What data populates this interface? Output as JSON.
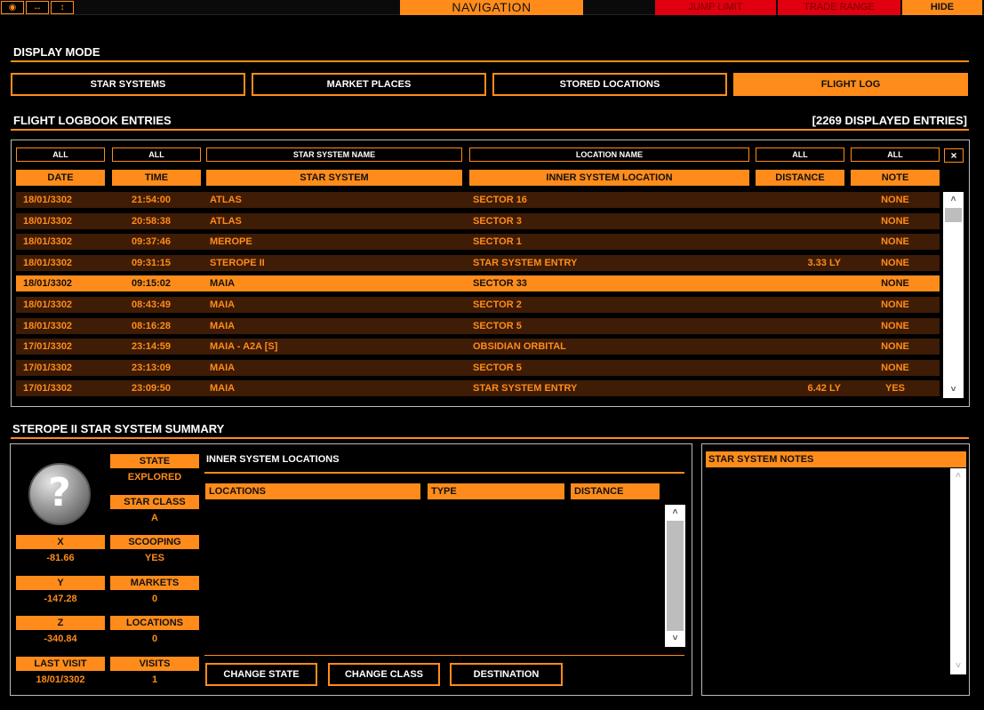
{
  "topbar": {
    "icons": [
      "eye-icon",
      "horizontal-arrows-icon",
      "vertical-arrows-icon"
    ],
    "icon_glyphs": [
      "◉",
      "↔",
      "↕"
    ],
    "title": "NAVIGATION",
    "jump_limit": "JUMP LIMIT",
    "trade_range": "TRADE RANGE",
    "hide": "HIDE"
  },
  "display_mode": {
    "title": "DISPLAY MODE",
    "buttons": [
      "STAR SYSTEMS",
      "MARKET PLACES",
      "STORED LOCATIONS",
      "FLIGHT LOG"
    ],
    "active": "FLIGHT LOG"
  },
  "logbook": {
    "title": "FLIGHT LOGBOOK ENTRIES",
    "count": "[2269 DISPLAYED ENTRIES]",
    "filters": [
      "ALL",
      "ALL",
      "STAR SYSTEM NAME",
      "LOCATION NAME",
      "ALL",
      "ALL"
    ],
    "clear": "×",
    "columns": [
      "DATE",
      "TIME",
      "STAR SYSTEM",
      "INNER SYSTEM LOCATION",
      "DISTANCE",
      "NOTE"
    ],
    "rows": [
      {
        "date": "18/01/3302",
        "time": "21:54:00",
        "system": "ATLAS",
        "location": "SECTOR 16",
        "distance": "",
        "note": "NONE"
      },
      {
        "date": "18/01/3302",
        "time": "20:58:38",
        "system": "ATLAS",
        "location": "SECTOR 3",
        "distance": "",
        "note": "NONE"
      },
      {
        "date": "18/01/3302",
        "time": "09:37:46",
        "system": "MEROPE",
        "location": "SECTOR 1",
        "distance": "",
        "note": "NONE"
      },
      {
        "date": "18/01/3302",
        "time": "09:31:15",
        "system": "STEROPE II",
        "location": "STAR SYSTEM ENTRY",
        "distance": "3.33 LY",
        "note": "NONE"
      },
      {
        "date": "18/01/3302",
        "time": "09:15:02",
        "system": "MAIA",
        "location": "SECTOR 33",
        "distance": "",
        "note": "NONE"
      },
      {
        "date": "18/01/3302",
        "time": "08:43:49",
        "system": "MAIA",
        "location": "SECTOR 2",
        "distance": "",
        "note": "NONE"
      },
      {
        "date": "18/01/3302",
        "time": "08:16:28",
        "system": "MAIA",
        "location": "SECTOR 5",
        "distance": "",
        "note": "NONE"
      },
      {
        "date": "17/01/3302",
        "time": "23:14:59",
        "system": "MAIA - A2A [S]",
        "location": "OBSIDIAN ORBITAL",
        "distance": "",
        "note": "NONE"
      },
      {
        "date": "17/01/3302",
        "time": "23:13:09",
        "system": "MAIA",
        "location": "SECTOR 5",
        "distance": "",
        "note": "NONE"
      },
      {
        "date": "17/01/3302",
        "time": "23:09:50",
        "system": "MAIA",
        "location": "STAR SYSTEM ENTRY",
        "distance": "6.42 LY",
        "note": "YES"
      }
    ],
    "selected_index": 4,
    "scroll_up": "˄",
    "scroll_down": "˅"
  },
  "summary": {
    "title": "STEROPE II STAR SYSTEM SUMMARY",
    "unknown_glyph": "?",
    "stats": [
      {
        "label": "STATE",
        "value": "EXPLORED"
      },
      {
        "label": "STAR CLASS",
        "value": "A"
      },
      {
        "label": "X",
        "value": "-81.66"
      },
      {
        "label": "SCOOPING",
        "value": "YES"
      },
      {
        "label": "Y",
        "value": "-147.28"
      },
      {
        "label": "MARKETS",
        "value": "0"
      },
      {
        "label": "Z",
        "value": "-340.84"
      },
      {
        "label": "LOCATIONS",
        "value": "0"
      },
      {
        "label": "LAST VISIT",
        "value": "18/01/3302"
      },
      {
        "label": "VISITS",
        "value": "1"
      }
    ],
    "inner_title": "INNER SYSTEM LOCATIONS",
    "inner_columns": [
      "LOCATIONS",
      "TYPE",
      "DISTANCE"
    ],
    "buttons": [
      "CHANGE STATE",
      "CHANGE CLASS",
      "DESTINATION"
    ],
    "notes_title": "STAR SYSTEM NOTES"
  },
  "colors": {
    "accent": "#ff8c1a",
    "row_bg": "#3f1c05",
    "alert": "#e0000f"
  }
}
